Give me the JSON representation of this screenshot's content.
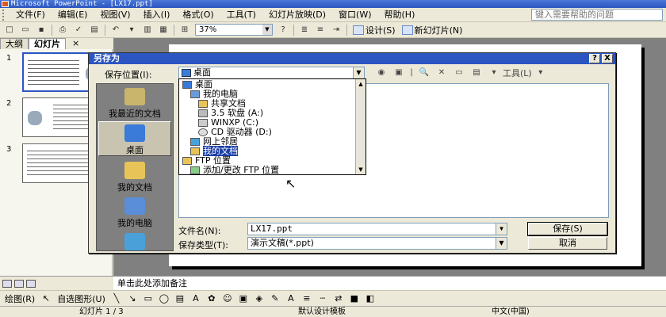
{
  "window": {
    "title": "Microsoft PowerPoint - [LX17.ppt]"
  },
  "menubar": {
    "items": [
      "文件(F)",
      "编辑(E)",
      "视图(V)",
      "插入(I)",
      "格式(O)",
      "工具(T)",
      "幻灯片放映(D)",
      "窗口(W)",
      "帮助(H)"
    ],
    "help_placeholder": "键入需要帮助的问题"
  },
  "toolbar": {
    "zoom": "37%",
    "design_label": "设计(S)",
    "new_slide_label": "新幻灯片(N)"
  },
  "outline_pane": {
    "tabs": [
      "大纲",
      "幻灯片"
    ],
    "close": "×",
    "slide_numbers": [
      "1",
      "2",
      "3"
    ]
  },
  "notes": {
    "placeholder": "单击此处添加备注"
  },
  "drawing_toolbar": {
    "draw_label": "绘图(R)",
    "autoshapes_label": "自选图形(U)"
  },
  "statusbar": {
    "slide": "幻灯片 1 / 3",
    "template": "默认设计模板",
    "language": "中文(中国)"
  },
  "save_dialog": {
    "title": "另存为",
    "help_btn": "?",
    "close_btn": "X",
    "save_in_label": "保存位置(I):",
    "save_in_value": "桌面",
    "tools_label": "工具(L)",
    "places": [
      {
        "label": "我最近的文档"
      },
      {
        "label": "桌面"
      },
      {
        "label": "我的文档"
      },
      {
        "label": "我的电脑"
      }
    ],
    "locations": [
      {
        "label": "桌面",
        "indent": 0
      },
      {
        "label": "我的电脑",
        "indent": 1
      },
      {
        "label": "共享文档",
        "indent": 2
      },
      {
        "label": "3.5 软盘 (A:)",
        "indent": 2
      },
      {
        "label": "WINXP (C:)",
        "indent": 2
      },
      {
        "label": "CD 驱动器 (D:)",
        "indent": 2
      },
      {
        "label": "网上邻居",
        "indent": 1
      },
      {
        "label": "我的文档",
        "indent": 1,
        "selected": true
      },
      {
        "label": "FTP 位置",
        "indent": 0
      },
      {
        "label": "添加/更改 FTP 位置",
        "indent": 1
      }
    ],
    "filename_label": "文件名(N):",
    "filename_value": "LX17.ppt",
    "filetype_label": "保存类型(T):",
    "filetype_value": "演示文稿(*.ppt)",
    "save_button": "保存(S)",
    "cancel_button": "取消"
  },
  "colors": {
    "title_bar": "#2b55c0",
    "selection": "#1c3fa6",
    "slide_area_bg": "#808080"
  }
}
